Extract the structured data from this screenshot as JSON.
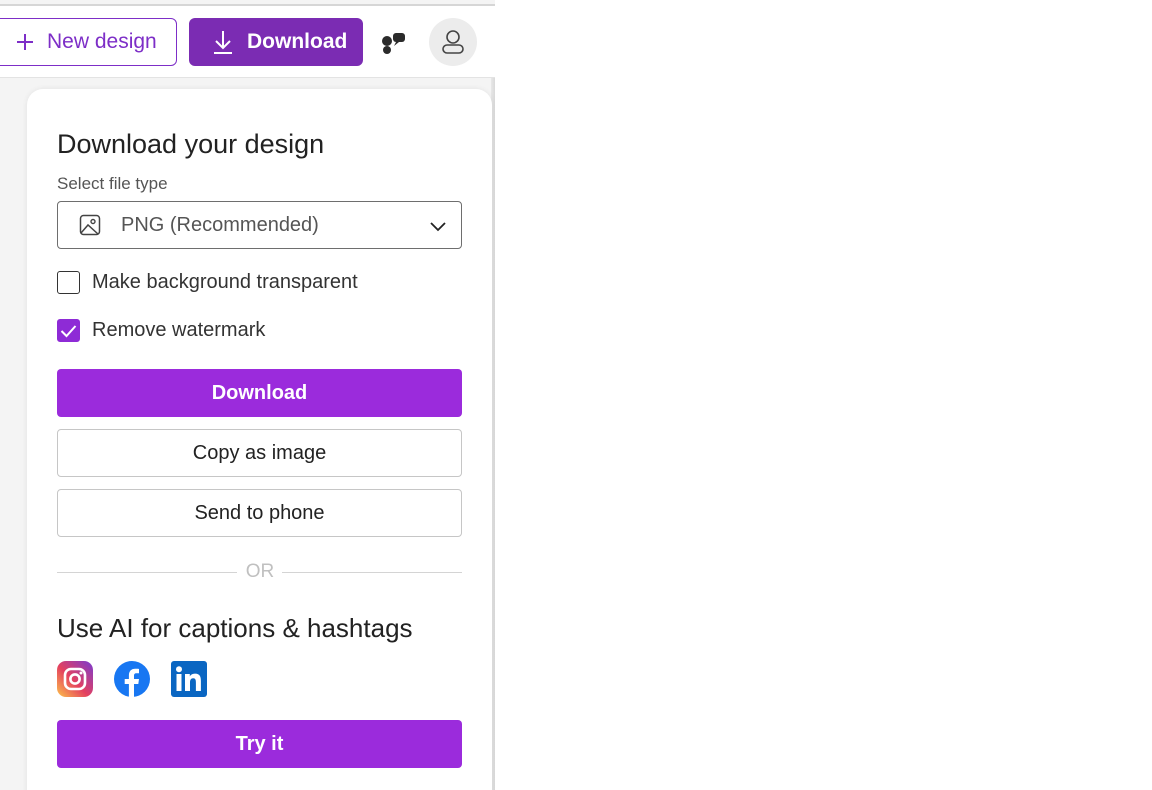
{
  "toolbar": {
    "new_design_label": "New design",
    "download_label": "Download"
  },
  "panel": {
    "title": "Download your design",
    "file_type_label": "Select file type",
    "file_type_value": "PNG (Recommended)",
    "options": [
      {
        "label": "Make background transparent",
        "checked": false
      },
      {
        "label": "Remove watermark",
        "checked": true
      }
    ],
    "download_button": "Download",
    "copy_button": "Copy as image",
    "send_button": "Send to phone",
    "or_text": "OR",
    "ai_title": "Use AI for captions & hashtags",
    "social_icons": [
      "instagram-icon",
      "facebook-icon",
      "linkedin-icon"
    ],
    "try_button": "Try it"
  },
  "colors": {
    "accent": "#9b2bdc",
    "accent_dark": "#7b2cb3",
    "instagram": "#e4405f",
    "facebook": "#1877f2",
    "linkedin": "#0a66c2"
  }
}
